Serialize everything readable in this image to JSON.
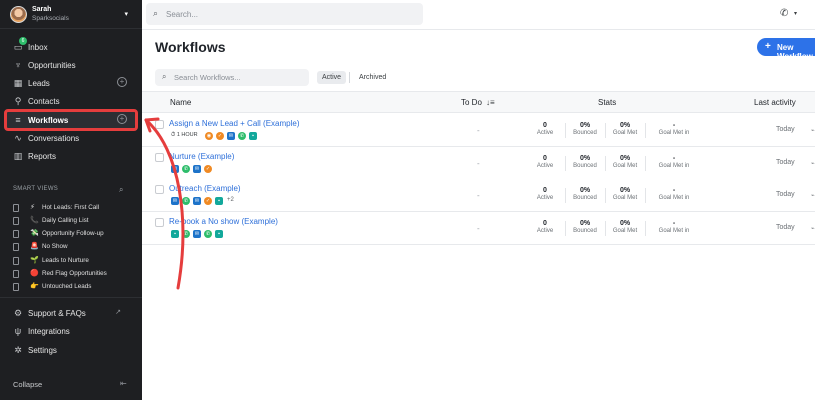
{
  "sidebar": {
    "user": {
      "name": "Sarah",
      "org": "Sparksocials"
    },
    "inbox_badge": "6",
    "nav": [
      {
        "id": "inbox",
        "label": "Inbox",
        "icon": "inbox-icon"
      },
      {
        "id": "opportunities",
        "label": "Opportunities",
        "icon": "trophy-icon"
      },
      {
        "id": "leads",
        "label": "Leads",
        "icon": "leads-icon",
        "has_add": true
      },
      {
        "id": "contacts",
        "label": "Contacts",
        "icon": "person-icon"
      },
      {
        "id": "workflows",
        "label": "Workflows",
        "icon": "list-icon",
        "has_add": true,
        "active": true
      },
      {
        "id": "conversations",
        "label": "Conversations",
        "icon": "waveform-icon"
      },
      {
        "id": "reports",
        "label": "Reports",
        "icon": "bar-chart-icon"
      }
    ],
    "smart_views_header": "SMART VIEWS",
    "smart_views": [
      {
        "emoji": "⚡",
        "label": "Hot Leads: First Call"
      },
      {
        "emoji": "📞",
        "label": "Daily Calling List"
      },
      {
        "emoji": "💸",
        "label": "Opportunity Follow-up"
      },
      {
        "emoji": "🚨",
        "label": "No Show"
      },
      {
        "emoji": "🌱",
        "label": "Leads to Nurture"
      },
      {
        "emoji": "🔴",
        "label": "Red Flag Opportunities"
      },
      {
        "emoji": "👉",
        "label": "Untouched Leads"
      }
    ],
    "bottom": [
      {
        "label": "Support & FAQs",
        "icon": "support-icon"
      },
      {
        "label": "Integrations",
        "icon": "plug-icon"
      },
      {
        "label": "Settings",
        "icon": "gear-icon"
      }
    ],
    "collapse_label": "Collapse"
  },
  "header": {
    "search_placeholder": "Search..."
  },
  "page": {
    "title": "Workflows",
    "new_button": "New Workflow",
    "search_placeholder": "Search Workflows...",
    "filter_active": "Active",
    "filter_archived": "Archived"
  },
  "table": {
    "columns": {
      "name": "Name",
      "todo": "To Do",
      "stats": "Stats",
      "last_activity": "Last activity"
    },
    "stat_labels": [
      "Active",
      "Bounced",
      "Goal Met",
      "Goal Met in"
    ],
    "rows": [
      {
        "name": "Assign a New Lead + Call (Example)",
        "wait": "1 HOUR",
        "steps": [
          "assign",
          "task",
          "email",
          "call",
          "sms"
        ],
        "more": "",
        "todo": "-",
        "stats": [
          "0",
          "0%",
          "0%",
          "-"
        ],
        "last": "Today"
      },
      {
        "name": "Nurture (Example)",
        "wait": "",
        "steps": [
          "email",
          "call",
          "email",
          "task"
        ],
        "more": "",
        "todo": "-",
        "stats": [
          "0",
          "0%",
          "0%",
          "-"
        ],
        "last": "Today"
      },
      {
        "name": "Outreach (Example)",
        "wait": "",
        "steps": [
          "email",
          "call",
          "email",
          "task",
          "sms"
        ],
        "more": "+2",
        "todo": "-",
        "stats": [
          "0",
          "0%",
          "0%",
          "-"
        ],
        "last": "Today"
      },
      {
        "name": "Re-book a No show (Example)",
        "wait": "",
        "steps": [
          "sms",
          "call",
          "email",
          "call",
          "sms"
        ],
        "more": "",
        "todo": "-",
        "stats": [
          "0",
          "0%",
          "0%",
          "-"
        ],
        "last": "Today"
      }
    ]
  },
  "colors": {
    "sidebar_bg": "#1e1f22",
    "accent_blue": "#2d72e8",
    "link_blue": "#2d6fd9",
    "highlight_red": "#e53d3d"
  }
}
